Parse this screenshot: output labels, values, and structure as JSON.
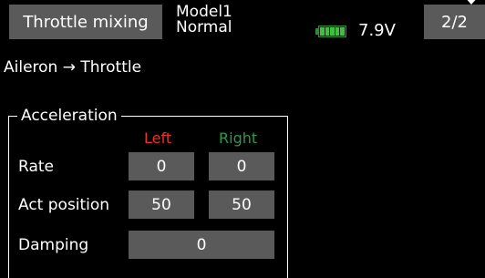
{
  "header": {
    "title": "Throttle mixing",
    "model_name": "Model1",
    "condition": "Normal",
    "battery_icon": "battery-icon",
    "voltage": "7.9V",
    "page": "2/2"
  },
  "section_title": "Aileron → Throttle",
  "group": {
    "label": "Acceleration",
    "columns": {
      "left": "Left",
      "right": "Right"
    },
    "rows": [
      {
        "label": "Rate",
        "left": "0",
        "right": "0"
      },
      {
        "label": "Act position",
        "left": "50",
        "right": "50"
      },
      {
        "label": "Damping",
        "value": "0"
      }
    ]
  },
  "colors": {
    "background": "#000000",
    "button": "#5a5a5a",
    "left_label": "#e8322e",
    "right_label": "#2d9a4a",
    "battery": "#3fbf3f"
  }
}
